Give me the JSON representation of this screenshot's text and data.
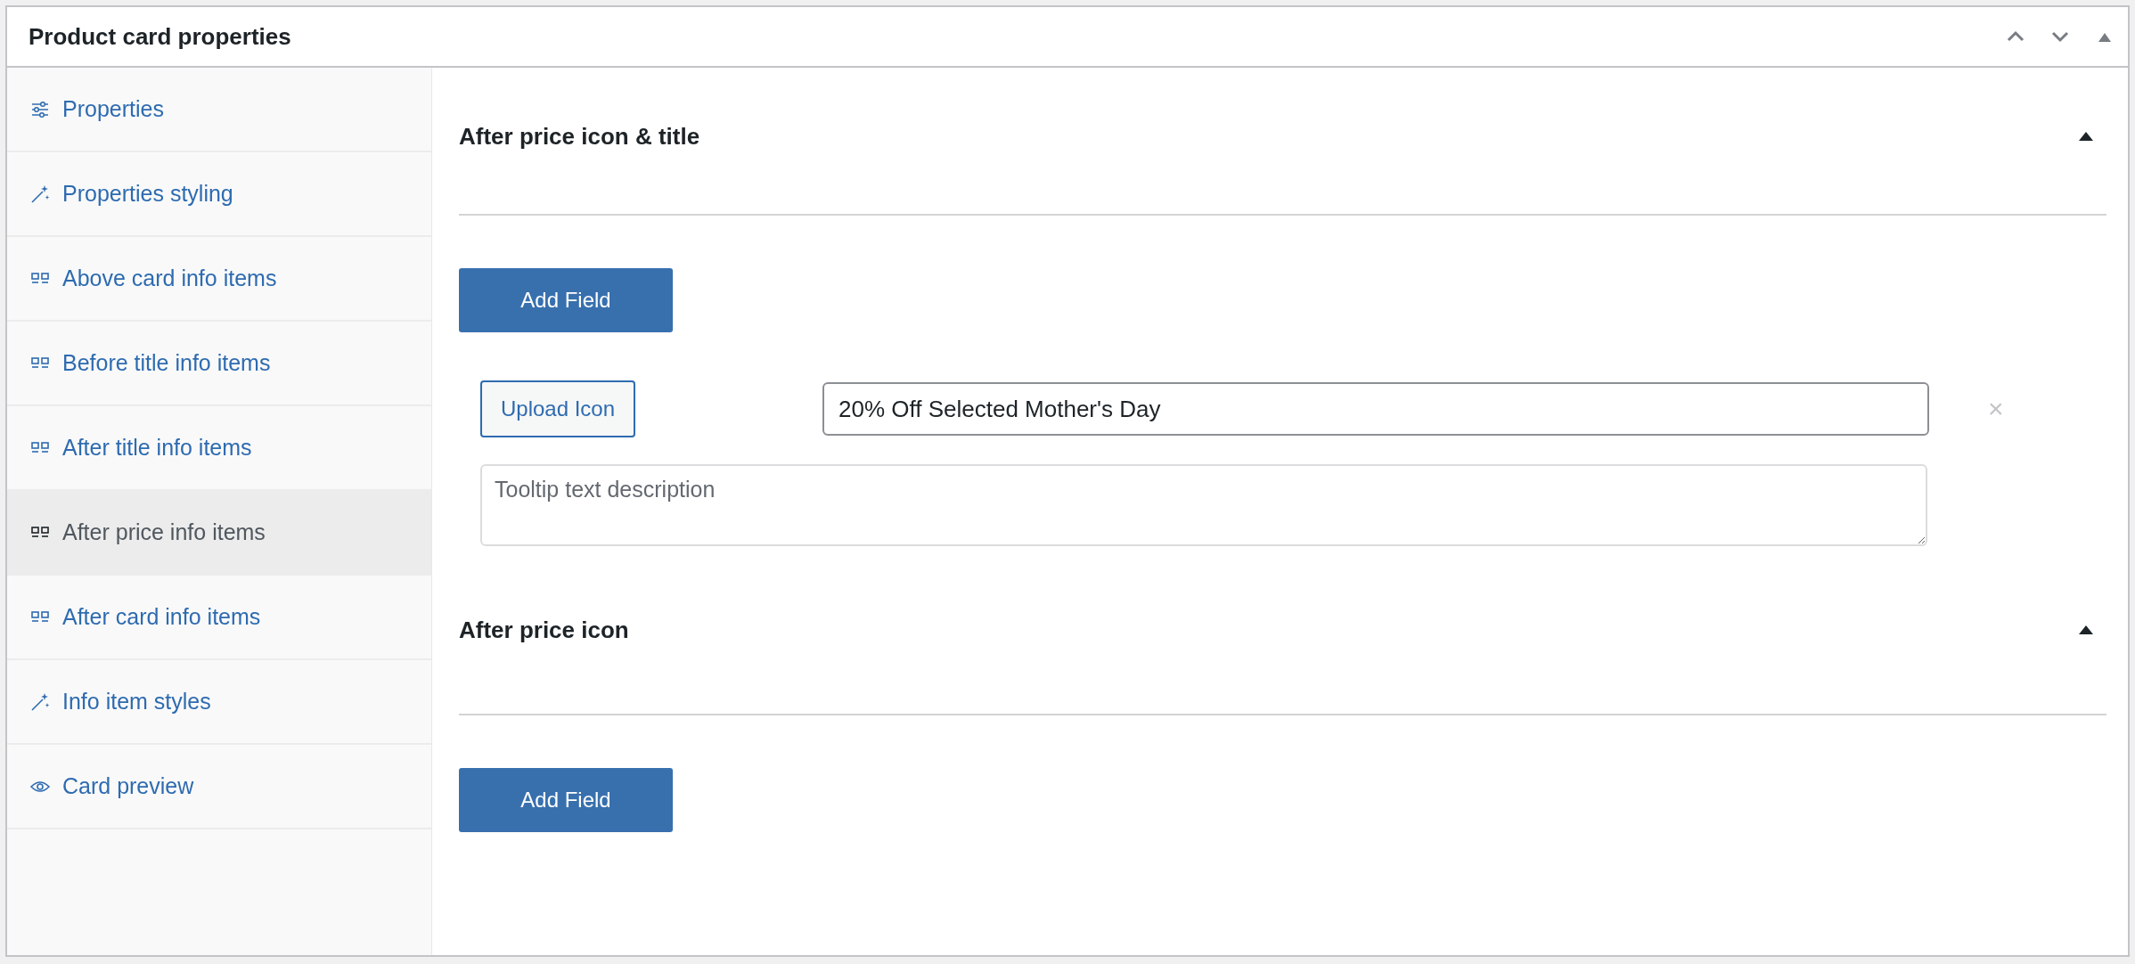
{
  "panel": {
    "title": "Product card properties",
    "controls": [
      {
        "kind": "up"
      },
      {
        "kind": "down"
      },
      {
        "kind": "toggle"
      }
    ]
  },
  "sidebar": {
    "items": [
      {
        "label": "Properties",
        "kind": "sliders",
        "selected": false
      },
      {
        "label": "Properties styling",
        "kind": "wand",
        "selected": false
      },
      {
        "label": "Above card info items",
        "kind": "blocks",
        "selected": false
      },
      {
        "label": "Before title info items",
        "kind": "blocks",
        "selected": false
      },
      {
        "label": "After title info items",
        "kind": "blocks",
        "selected": false
      },
      {
        "label": "After price info items",
        "kind": "blocks",
        "selected": true
      },
      {
        "label": "After card info items",
        "kind": "blocks",
        "selected": false
      },
      {
        "label": "Info item styles",
        "kind": "wand",
        "selected": false
      },
      {
        "label": "Card preview",
        "kind": "eye",
        "selected": false
      }
    ]
  },
  "sections": [
    {
      "title": "After price icon & title",
      "expanded": true,
      "fields": [
        {
          "upload_label": "Upload Icon",
          "title_value": "20% Off Selected Mother's Day",
          "remove": "×",
          "tooltip_placeholder": "Tooltip text description"
        }
      ],
      "add_label": "Add Field"
    },
    {
      "title": "After price icon",
      "expanded": true,
      "add_label": "Add Field"
    }
  ]
}
